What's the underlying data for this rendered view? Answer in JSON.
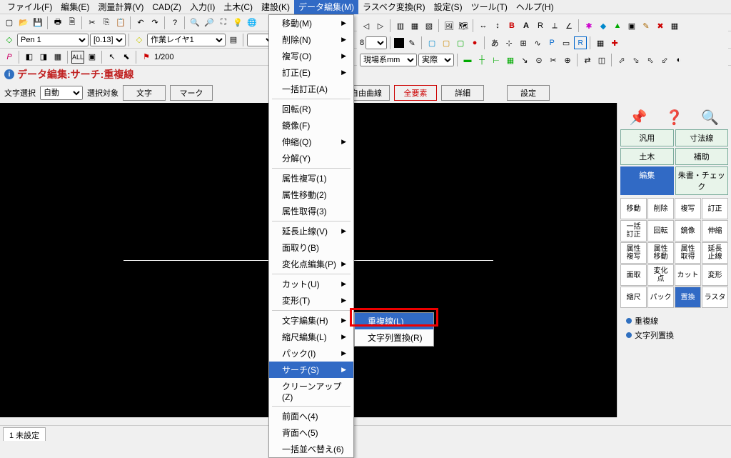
{
  "menubar": [
    {
      "label": "ファイル(F)"
    },
    {
      "label": "編集(E)"
    },
    {
      "label": "測量計算(V)"
    },
    {
      "label": "CAD(Z)"
    },
    {
      "label": "入力(I)"
    },
    {
      "label": "土木(C)"
    },
    {
      "label": "建設(K)"
    },
    {
      "label": "データ編集(M)",
      "active": true
    },
    {
      "label": "ラスベク変換(R)"
    },
    {
      "label": "設定(S)"
    },
    {
      "label": "ツール(T)"
    },
    {
      "label": "ヘルプ(H)"
    }
  ],
  "toolbar2": {
    "pen_label": "Pen 1",
    "pen_size": "[0.13]",
    "layer": "作業レイヤ1"
  },
  "toolbar3": {
    "scale": "1/200",
    "coord_sys": "現場系mm",
    "mode": "実際"
  },
  "title": {
    "text": "データ編集:サーチ:重複線"
  },
  "button_row": {
    "select_label": "文字選択",
    "select_mode": "自動",
    "target_label": "選択対象",
    "buttons": [
      "文字",
      "マーク"
    ],
    "buttons2": [
      "自由曲線",
      "全要素",
      "詳細"
    ],
    "settings": "設定"
  },
  "right_panel": {
    "tabs": [
      {
        "label": "汎用"
      },
      {
        "label": "寸法線"
      },
      {
        "label": "土木"
      },
      {
        "label": "補助"
      },
      {
        "label": "編集",
        "active": true
      },
      {
        "label": "朱書・チェック"
      }
    ],
    "grid": [
      "移動",
      "削除",
      "複写",
      "訂正",
      "一括\n訂正",
      "回転",
      "鏡像",
      "伸縮",
      "属性\n複写",
      "属性\n移動",
      "属性\n取得",
      "延長\n止線",
      "面取",
      "変化\n点",
      "カット",
      "変形",
      "縮尺",
      "パック",
      "置換",
      "ラスタ"
    ],
    "grid_active_index": 18,
    "sub_items": [
      "重複線",
      "文字列置換"
    ]
  },
  "dropdown": {
    "items": [
      {
        "label": "移動(M)",
        "arrow": true
      },
      {
        "label": "削除(N)",
        "arrow": true
      },
      {
        "label": "複写(O)",
        "arrow": true
      },
      {
        "label": "訂正(E)",
        "arrow": true
      },
      {
        "label": "一括訂正(A)"
      },
      {
        "sep": true
      },
      {
        "label": "回転(R)"
      },
      {
        "label": "鏡像(F)"
      },
      {
        "label": "伸縮(Q)",
        "arrow": true
      },
      {
        "label": "分解(Y)"
      },
      {
        "sep": true
      },
      {
        "label": "属性複写(1)"
      },
      {
        "label": "属性移動(2)"
      },
      {
        "label": "属性取得(3)"
      },
      {
        "sep": true
      },
      {
        "label": "延長止線(V)",
        "arrow": true
      },
      {
        "label": "面取り(B)"
      },
      {
        "label": "変化点編集(P)",
        "arrow": true
      },
      {
        "sep": true
      },
      {
        "label": "カット(U)",
        "arrow": true
      },
      {
        "label": "変形(T)",
        "arrow": true
      },
      {
        "sep": true
      },
      {
        "label": "文字編集(H)",
        "arrow": true
      },
      {
        "label": "縮尺編集(L)",
        "arrow": true
      },
      {
        "label": "パック(I)",
        "arrow": true
      },
      {
        "label": "サーチ(S)",
        "arrow": true,
        "highlight": true
      },
      {
        "label": "クリーンアップ(Z)"
      },
      {
        "sep": true
      },
      {
        "label": "前面へ(4)"
      },
      {
        "label": "背面へ(5)"
      },
      {
        "label": "一括並べ替え(6)"
      }
    ]
  },
  "submenu": {
    "items": [
      {
        "label": "重複線(L)",
        "highlight": true
      },
      {
        "label": "文字列置換(R)"
      }
    ]
  },
  "statusbar": {
    "tab": "1 未設定"
  }
}
